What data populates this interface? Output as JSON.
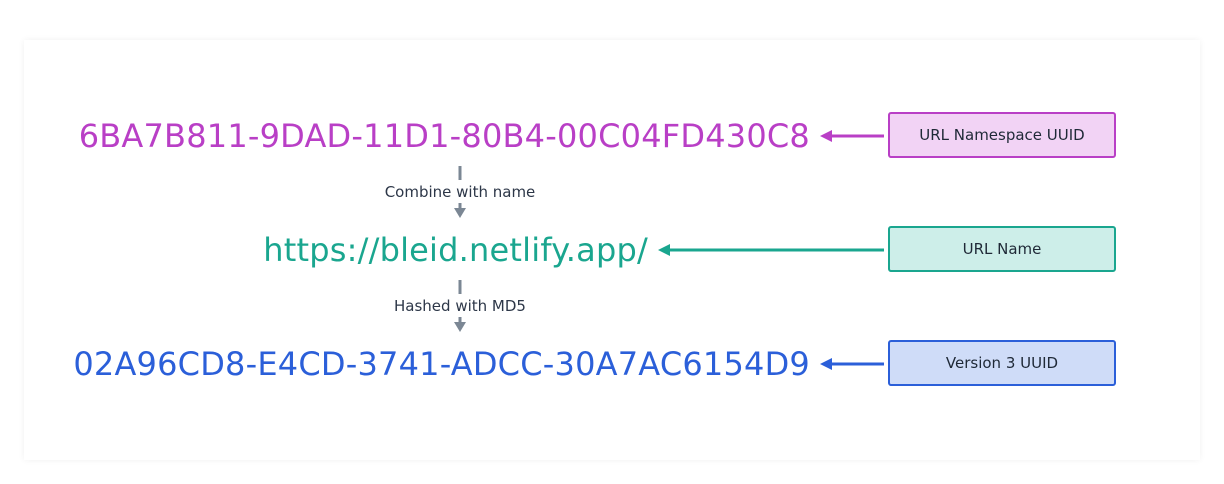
{
  "diagram": {
    "namespace_uuid": "6BA7B811-9DAD-11D1-80B4-00C04FD430C8",
    "name_value": "https://bleid.netlify.app/",
    "result_uuid": "02A96CD8-E4CD-3741-ADCC-30A7AC6154D9",
    "step_combine": "Combine with name",
    "step_hash": "Hashed with MD5",
    "label_namespace": "URL Namespace UUID",
    "label_name": "URL Name",
    "label_result": "Version 3 UUID"
  },
  "colors": {
    "namespace": "#b93fc6",
    "name": "#1aa68f",
    "result": "#2b5fd9",
    "flow": "#7b8794"
  }
}
